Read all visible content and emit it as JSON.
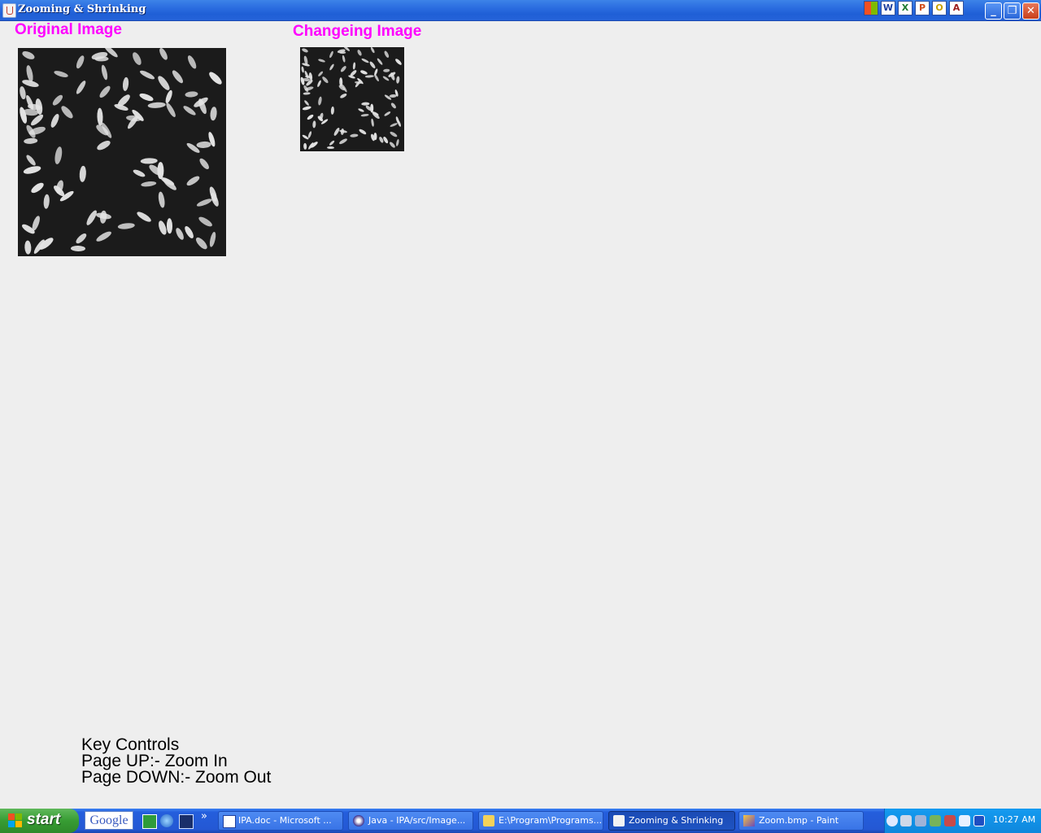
{
  "window": {
    "title": "Zooming & Shrinking",
    "quick_icons": [
      "W",
      "X",
      "P",
      "O",
      "A"
    ]
  },
  "content": {
    "original_label": "Original Image",
    "changing_label": "Changeing Image",
    "label_color": "#ff00ff",
    "key_controls": {
      "heading": "Key Controls",
      "page_up": "Page UP:- Zoom In",
      "page_down": "Page DOWN:- Zoom Out"
    }
  },
  "taskbar": {
    "start_label": "start",
    "google_label": "Google",
    "overflow_label": "»",
    "tasks": [
      {
        "label": "IPA.doc - Microsoft ...",
        "icon": "word-icon"
      },
      {
        "label": "Java - IPA/src/Image...",
        "icon": "eclipse-icon"
      },
      {
        "label": "E:\\Program\\Programs...",
        "icon": "folder-icon"
      },
      {
        "label": "Zooming & Shrinking",
        "icon": "java-icon",
        "active": true
      },
      {
        "label": "Zoom.bmp - Paint",
        "icon": "paint-icon"
      }
    ],
    "clock": "10:27 AM"
  }
}
